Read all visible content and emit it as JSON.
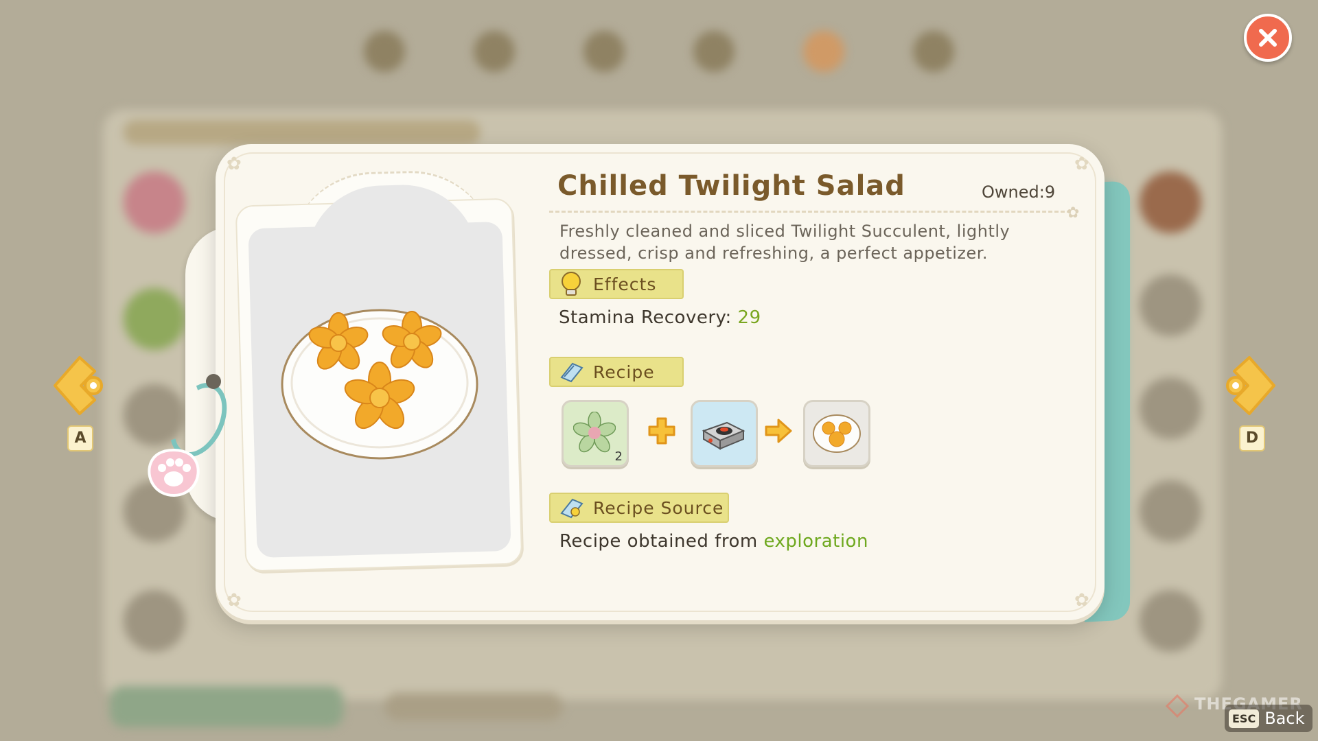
{
  "dialog": {
    "title": "Chilled Twilight Salad",
    "owned": "Owned:9",
    "description": "Freshly cleaned and sliced Twilight Succulent, lightly dressed, crisp and refreshing, a perfect appetizer.",
    "item_image_icon": "chilled-twilight-salad"
  },
  "effects": {
    "header": "Effects",
    "stat_label": "Stamina Recovery:",
    "stat_value": "29"
  },
  "recipe": {
    "header": "Recipe",
    "ingredient": {
      "icon": "twilight-succulent",
      "count": "2"
    },
    "tool": {
      "icon": "cooking-stove"
    },
    "result": {
      "icon": "chilled-twilight-salad"
    }
  },
  "recipe_source": {
    "header": "Recipe Source",
    "text": "Recipe obtained from",
    "link": "exploration"
  },
  "nav": {
    "prev_key": "A",
    "next_key": "D"
  },
  "footer": {
    "esc_key": "ESC",
    "back_label": "Back",
    "watermark": "THEGAMER"
  },
  "colors": {
    "card_bg": "#faf7ee",
    "title": "#7a5a2b",
    "section_bg": "#e9e28a",
    "accent_green": "#7aa620",
    "close_red": "#f06a4e",
    "nav_yellow": "#f5c44a"
  }
}
